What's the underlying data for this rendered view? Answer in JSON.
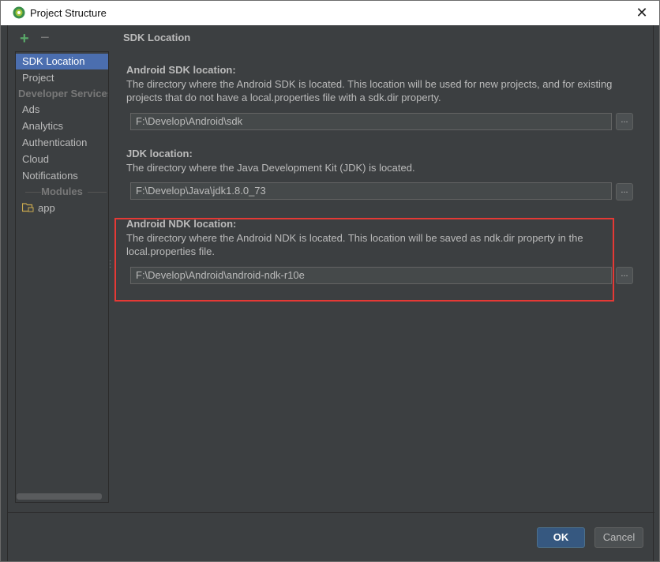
{
  "window": {
    "title": "Project Structure",
    "close_glyph": "✕"
  },
  "toolbar": {
    "add_glyph": "+",
    "remove_glyph": "−"
  },
  "sidebar": {
    "items": [
      {
        "label": "SDK Location",
        "selected": true
      },
      {
        "label": "Project"
      }
    ],
    "developer_services_header": "Developer Services",
    "services": [
      {
        "label": "Ads"
      },
      {
        "label": "Analytics"
      },
      {
        "label": "Authentication"
      },
      {
        "label": "Cloud"
      },
      {
        "label": "Notifications"
      }
    ],
    "modules_header": "Modules",
    "modules": [
      {
        "label": "app",
        "icon": "module-folder-icon"
      }
    ]
  },
  "main": {
    "section_title": "SDK Location",
    "sdk": {
      "label": "Android SDK location:",
      "description": "The directory where the Android SDK is located. This location will be used for new projects, and for existing projects that do not have a local.properties file with a sdk.dir property.",
      "value": "F:\\Develop\\Android\\sdk",
      "browse_label": "..."
    },
    "jdk": {
      "label": "JDK location:",
      "description": "The directory where the Java Development Kit (JDK) is located.",
      "value": "F:\\Develop\\Java\\jdk1.8.0_73",
      "browse_label": "..."
    },
    "ndk": {
      "label": "Android NDK location:",
      "description": "The directory where the Android NDK is located. This location will be saved as ndk.dir property in the local.properties file.",
      "value": "F:\\Develop\\Android\\android-ndk-r10e",
      "browse_label": "..."
    }
  },
  "buttons": {
    "ok": "OK",
    "cancel": "Cancel"
  },
  "colors": {
    "background": "#3c3f41",
    "selection": "#4b6eaf",
    "highlight_border": "#e53935",
    "ok_button": "#365880"
  }
}
